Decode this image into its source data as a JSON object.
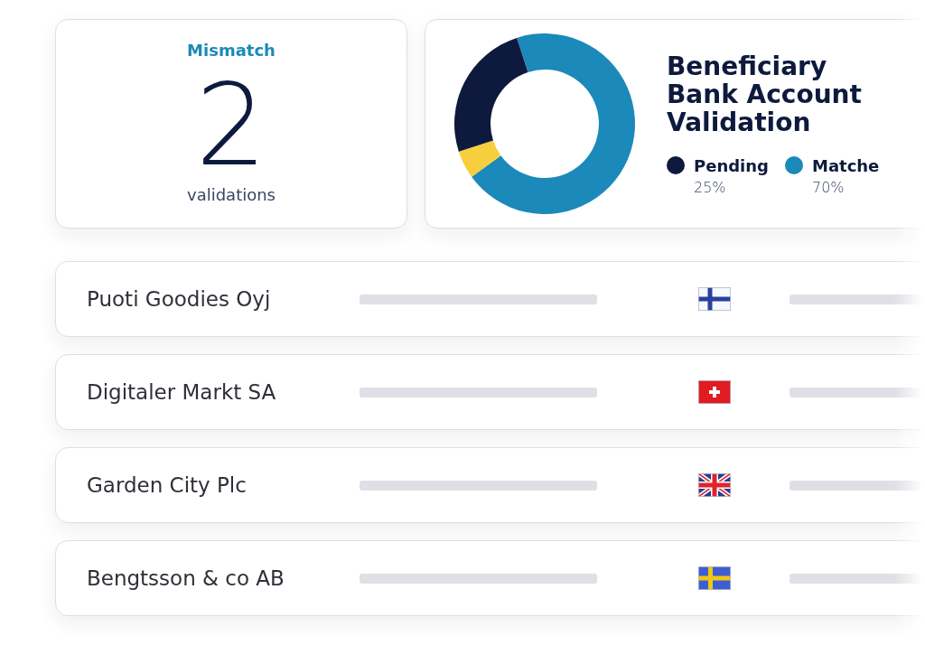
{
  "summary_card": {
    "label": "Mismatch",
    "count": "2",
    "caption": "validations"
  },
  "chart_card": {
    "title": "Beneficiary Bank Account Validation",
    "chart_data": {
      "type": "donut",
      "values": [
        70,
        5,
        25
      ],
      "colors": [
        "#1b89b9",
        "#f7cf3e",
        "#0e1a3d"
      ]
    },
    "legend": [
      {
        "label": "Pending",
        "value": "25%",
        "color": "#0e1a3d"
      },
      {
        "label": "Matche",
        "value": "70%",
        "color": "#1b89b9"
      }
    ]
  },
  "rows": [
    {
      "name": "Puoti Goodies Oyj",
      "kind": "fi"
    },
    {
      "name": "Digitaler Markt SA",
      "kind": "ch"
    },
    {
      "name": "Garden City Plc",
      "kind": "gb"
    },
    {
      "name": "Bengtsson & co AB",
      "kind": "se"
    }
  ]
}
